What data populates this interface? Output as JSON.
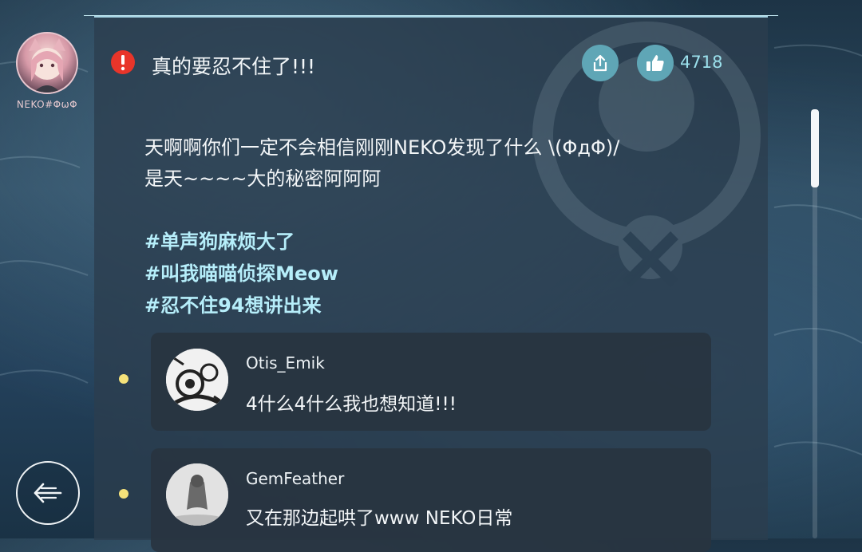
{
  "user": {
    "name": "NEKO#ΦωΦ",
    "avatar_icon": "cat-girl-avatar"
  },
  "post": {
    "alert_icon": "alert-icon",
    "title": "真的要忍不住了!!!",
    "body_line1": "天啊啊你们一定不会相信刚刚NEKO发现了什么 \\(ΦдΦ)/",
    "body_line2": "是天~~~~大的秘密阿阿阿",
    "tags": [
      "#单声狗麻烦大了",
      "#叫我喵喵侦探Meow",
      "#忍不住94想讲出来"
    ],
    "like_count": "4718"
  },
  "comments": [
    {
      "author": "Otis_Emik",
      "text": "4什么4什么我也想知道!!!"
    },
    {
      "author": "GemFeather",
      "text": "又在那边起哄了www NEKO日常"
    }
  ],
  "colors": {
    "accent": "#5fa6b6",
    "tag": "#b6eefa",
    "dot": "#f5e27a",
    "alert": "#e8352a"
  }
}
